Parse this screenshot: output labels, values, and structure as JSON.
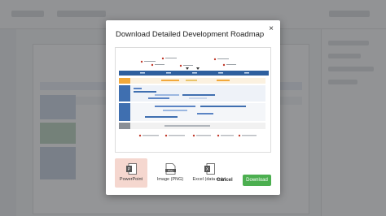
{
  "dialog": {
    "title": "Download Detailed Development Roadmap",
    "close_glyph": "×",
    "formats": [
      {
        "label": "PowerPoint",
        "icon": "powerpoint-file-icon",
        "selected": true
      },
      {
        "label": "Image (PNG)",
        "icon": "png-file-icon",
        "selected": false
      },
      {
        "label": "Excel (data only)",
        "icon": "excel-file-icon",
        "selected": false
      }
    ],
    "cancel_label": "Cancel",
    "download_label": "Download"
  },
  "colors": {
    "accent_green": "#4caf50",
    "selected_option": "#f5d7cf",
    "timeline_blue": "#2e5f9e",
    "swimlane_orange": "#f2a93b",
    "swimlane_blue": "#3f6fb0",
    "swimlane_gray": "#8a8f96",
    "overlay": "#3c3e42"
  }
}
